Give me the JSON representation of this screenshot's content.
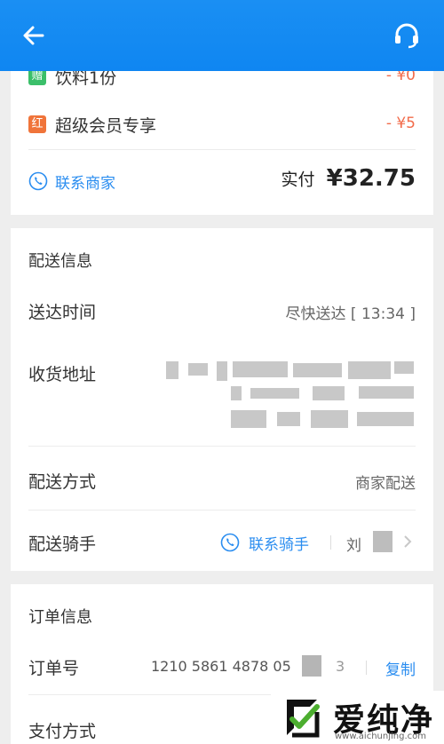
{
  "order_items": [
    {
      "badge": "赠",
      "badge_color": "#3bbf6a",
      "name": "饮料1份",
      "discount": "- ¥0"
    },
    {
      "badge": "红",
      "badge_color": "#f0743a",
      "name": "超级会员专享",
      "discount": "- ¥5"
    }
  ],
  "contact_merchant": "联系商家",
  "paid_label": "实付",
  "paid_amount": "¥32.75",
  "delivery": {
    "section_title": "配送信息",
    "time_label": "送达时间",
    "time_value": "尽快送达 [ 13:34 ]",
    "address_label": "收货地址",
    "method_label": "配送方式",
    "method_value": "商家配送",
    "rider_label": "配送骑手",
    "contact_rider": "联系骑手",
    "rider_name": "刘"
  },
  "order_info": {
    "section_title": "订单信息",
    "order_no_label": "订单号",
    "order_no_value": "1210 5861 4878 05",
    "order_no_tail": "3",
    "copy_label": "复制",
    "payment_label": "支付方式"
  },
  "watermark": {
    "text": "爱纯净",
    "url": "www.aichunjing.com"
  },
  "colors": {
    "header": "#1a8ff3",
    "accent": "#2a8df0",
    "discount": "#f26b4a"
  }
}
